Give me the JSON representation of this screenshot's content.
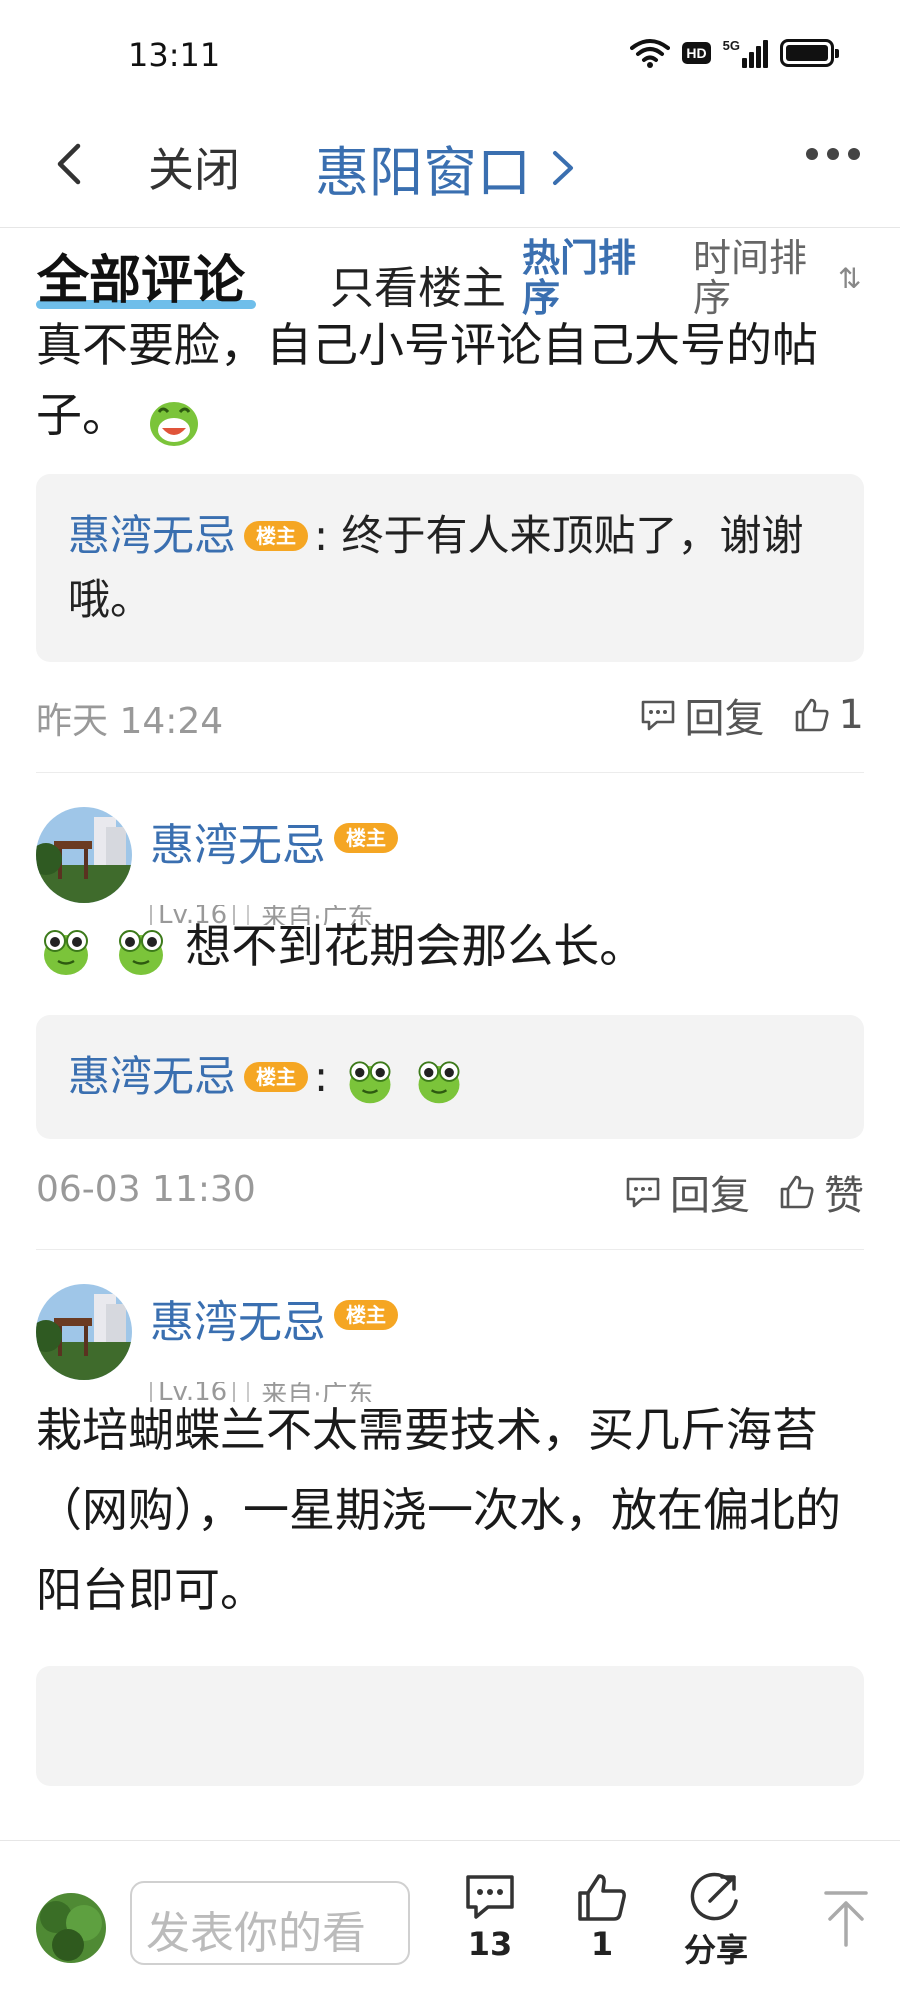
{
  "status_bar": {
    "time": "13:11",
    "hd_label": "HD",
    "network_label": "5G",
    "icons": [
      "wifi-icon",
      "hd-icon",
      "signal-5g-icon",
      "battery-icon"
    ]
  },
  "nav": {
    "close_label": "关闭",
    "title": "惠阳窗口",
    "icons": [
      "back-arrow-icon",
      "chevron-right-icon",
      "more-dots-icon"
    ]
  },
  "tabs": {
    "all_comments": "全部评论",
    "only_op": "只看楼主",
    "hot_sort": "热门排序",
    "time_sort": "时间排序"
  },
  "comments": [
    {
      "text": "真不要脸，自己小号评论自己大号的帖子。",
      "emoji": "laughing-frog-emoji",
      "reply": {
        "name": "惠湾无忌",
        "op_tag": "楼主",
        "text": ": 终于有人来顶贴了，谢谢哦。"
      },
      "time": "昨天 14:24",
      "reply_label": "回复",
      "like_label": "1"
    },
    {
      "user": {
        "name": "惠湾无忌",
        "op_tag": "楼主",
        "level": "Lv.16",
        "location": "来自·广东"
      },
      "text": "想不到花期会那么长。",
      "emojis": [
        "frog-emoji",
        "frog-emoji"
      ],
      "reply": {
        "name": "惠湾无忌",
        "op_tag": "楼主",
        "text": ":"
      },
      "time": "06-03 11:30",
      "reply_label": "回复",
      "like_label": "赞"
    },
    {
      "user": {
        "name": "惠湾无忌",
        "op_tag": "楼主",
        "level": "Lv.16",
        "location": "来自·广东"
      },
      "text": "栽培蝴蝶兰不太需要技术，买几斤海苔（网购），一星期浇一次水，放在偏北的阳台即可。"
    }
  ],
  "bottom_bar": {
    "input_placeholder": "发表你的看",
    "comment_count": "13",
    "like_count": "1",
    "share_label": "分享"
  },
  "colors": {
    "link_blue": "#3a6fb0",
    "op_tag_orange": "#f5a623",
    "tab_underline": "#56b3e6",
    "reply_bg": "#f3f3f3"
  }
}
